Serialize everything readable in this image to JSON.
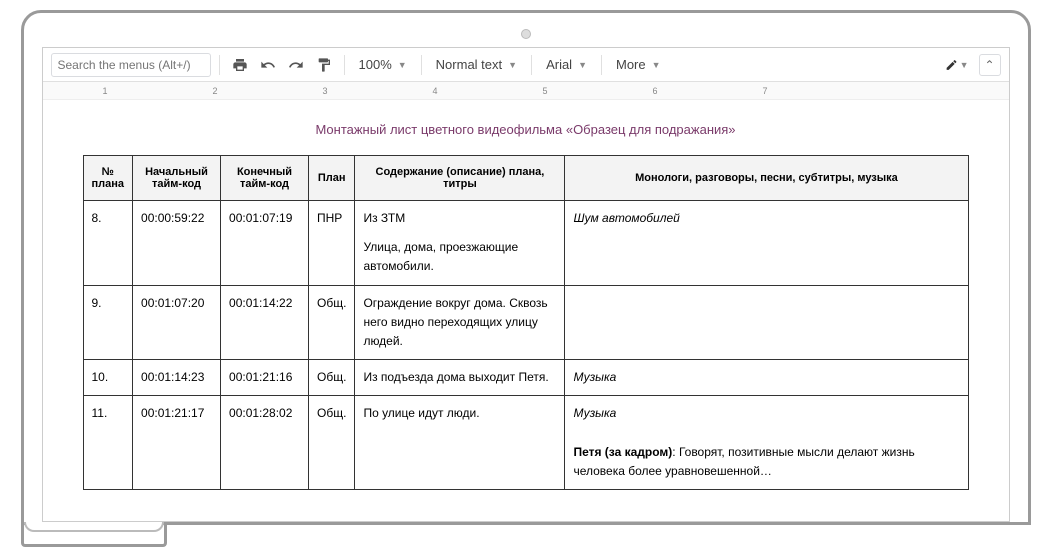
{
  "toolbar": {
    "search_placeholder": "Search the menus (Alt+/)",
    "zoom": "100%",
    "style": "Normal text",
    "font": "Arial",
    "more": "More"
  },
  "ruler": [
    "1",
    "2",
    "3",
    "4",
    "5",
    "6",
    "7"
  ],
  "doc": {
    "title": "Монтажный лист цветного видеофильма «Образец для подражания»",
    "headers": {
      "n": "№ плана",
      "tc_start": "Начальный тайм-код",
      "tc_end": "Конечный тайм-код",
      "plan": "План",
      "desc": "Содержание (описание) плана, титры",
      "audio": "Монологи, разговоры, песни, субтитры, музыка"
    },
    "rows": [
      {
        "n": "8.",
        "tc_start": "00:00:59:22",
        "tc_end": "00:01:07:19",
        "plan": "ПНР",
        "desc": [
          "Из ЗТМ",
          "Улица, дома, проезжающие автомобили."
        ],
        "audio": "<em>Шум автомобилей</em>"
      },
      {
        "n": "9.",
        "tc_start": "00:01:07:20",
        "tc_end": "00:01:14:22",
        "plan": "Общ.",
        "desc": [
          "Ограждение вокруг дома. Сквозь него видно переходящих улицу людей."
        ],
        "audio": ""
      },
      {
        "n": "10.",
        "tc_start": "00:01:14:23",
        "tc_end": "00:01:21:16",
        "plan": "Общ.",
        "desc": [
          "Из подъезда дома выходит Петя."
        ],
        "audio": "<em>Музыка</em>"
      },
      {
        "n": "11.",
        "tc_start": "00:01:21:17",
        "tc_end": "00:01:28:02",
        "plan": "Общ.",
        "desc": [
          "По улице идут люди."
        ],
        "audio": "<em>Музыка</em><br><br><strong>Петя (за кадром)</strong>: Говорят, позитивные мысли делают жизнь человека более уравновешенной…"
      }
    ]
  }
}
